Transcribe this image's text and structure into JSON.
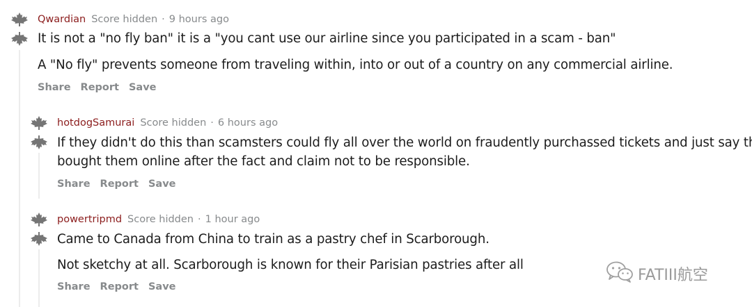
{
  "comments": [
    {
      "author": "Qwardian",
      "score": "Score hidden",
      "separator": "·",
      "time": "9 hours ago",
      "paragraphs": [
        "It is not a \"no fly ban\" it is a \"you cant use our airline since you participated in a scam - ban\"",
        "A \"No fly\" prevents someone from traveling within, into or out of a country on any commercial airline."
      ],
      "actions": [
        "Share",
        "Report",
        "Save"
      ]
    },
    {
      "author": "hotdogSamurai",
      "score": "Score hidden",
      "separator": "·",
      "time": "6 hours ago",
      "paragraphs": [
        "If they didn't do this than scamsters could fly all over the world on fraudently purchassed tickets and just say they",
        "bought them online after the fact and claim not to be responsible."
      ],
      "actions": [
        "Share",
        "Report",
        "Save"
      ]
    },
    {
      "author": "powertripmd",
      "score": "Score hidden",
      "separator": "·",
      "time": "1 hour ago",
      "paragraphs": [
        "Came to Canada from China to train as a pastry chef in Scarborough.",
        "Not sketchy at all. Scarborough is known for their Parisian pastries after all"
      ],
      "actions": [
        "Share",
        "Report",
        "Save"
      ]
    }
  ],
  "icons": {
    "upvote": "maple-leaf-up-icon",
    "downvote": "maple-leaf-down-icon"
  },
  "watermark": {
    "text": "FATIII航空",
    "icon": "wechat-icon"
  },
  "colors": {
    "author": "#8b1c1c",
    "meta": "#878a8c",
    "body": "#1c1c1c",
    "vote_icon": "#757575"
  }
}
